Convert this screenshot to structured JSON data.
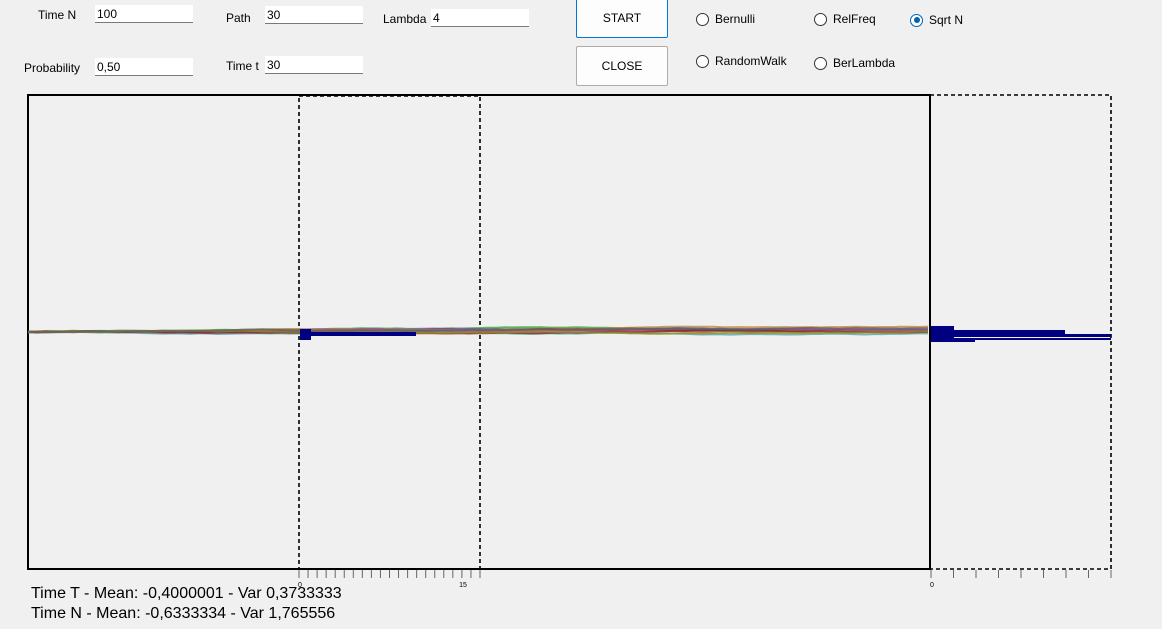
{
  "controls": {
    "time_n": {
      "label": "Time N",
      "value": "100"
    },
    "probability": {
      "label": "Probability",
      "value": "0,50"
    },
    "path": {
      "label": "Path",
      "value": "30"
    },
    "time_t": {
      "label": "Time t",
      "value": "30"
    },
    "lambda": {
      "label": "Lambda",
      "value": "4"
    }
  },
  "buttons": {
    "start": "START",
    "close": "CLOSE"
  },
  "modes": [
    {
      "label": "Bernulli",
      "selected": false
    },
    {
      "label": "RelFreq",
      "selected": false
    },
    {
      "label": "Sqrt N",
      "selected": true
    },
    {
      "label": "RandomWalk",
      "selected": false
    },
    {
      "label": "BerLambda",
      "selected": false
    }
  ],
  "axis": {
    "mid_start": "0",
    "mid_end": "15",
    "right_start": "0"
  },
  "stats": {
    "time_t": "Time T - Mean: -0,4000001 - Var 0,3733333",
    "time_n": "Time N - Mean: -0,6333334 - Var 1,765556"
  },
  "colors": {
    "accent": "#0078d7",
    "histogram": "#000080"
  }
}
